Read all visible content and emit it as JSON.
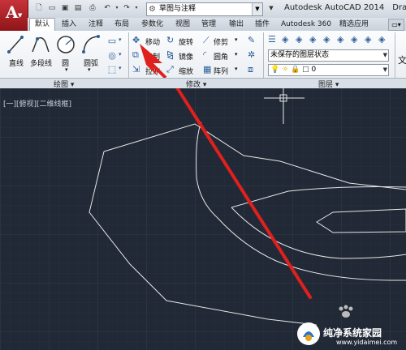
{
  "titlebar": {
    "workspace": "草图与注释",
    "app_name": "Autodesk AutoCAD 2014",
    "file_name": "Draw"
  },
  "tabs": [
    "默认",
    "插入",
    "注释",
    "布局",
    "参数化",
    "视图",
    "管理",
    "输出",
    "插件",
    "Autodesk 360",
    "精选应用"
  ],
  "ribbon": {
    "draw": {
      "line": "直线",
      "polyline": "多段线",
      "circle": "圆",
      "arc": "圆弧",
      "title": "绘图"
    },
    "modify": {
      "move": "移动",
      "rotate": "旋转",
      "trim": "修剪",
      "copy": "复制",
      "mirror": "镜像",
      "fillet": "圆角",
      "stretch": "拉伸",
      "scale": "缩放",
      "array": "阵列",
      "title": "修改"
    },
    "layers": {
      "state": "未保存的图层状态",
      "current": "0",
      "title": "图层"
    },
    "annotation": {
      "text": "文"
    }
  },
  "viewport": {
    "label": "[一][俯视][二维线框]"
  },
  "watermark": {
    "text": "纯净系统家园",
    "url": "www.yidaimei.com"
  },
  "colors": {
    "canvas": "#212936",
    "arrow": "#e0201c",
    "lines": "#e6e6e6",
    "app_button": "#b8262d"
  }
}
